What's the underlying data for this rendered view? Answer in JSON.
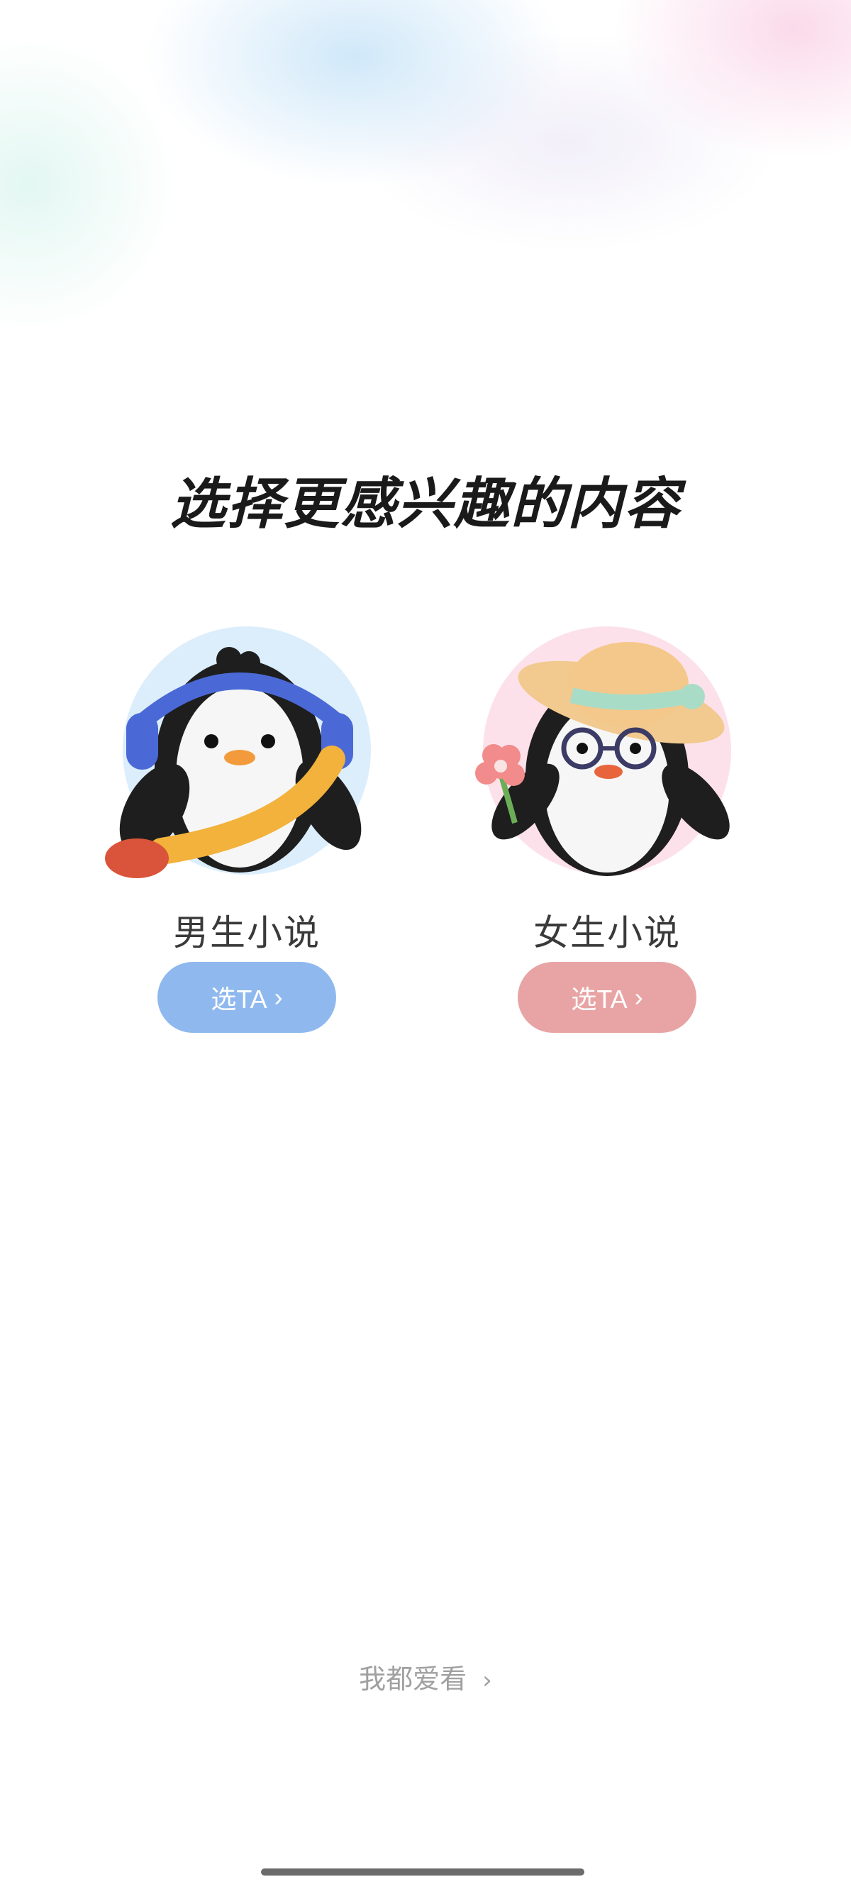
{
  "page": {
    "title": "选择更感兴趣的内容"
  },
  "options": [
    {
      "label": "男生小说",
      "button_label": "选TA",
      "button_chevron": "›",
      "accent": "#8fb9ee",
      "avatar_icon": "penguin-headphones-icon"
    },
    {
      "label": "女生小说",
      "button_label": "选TA",
      "button_chevron": "›",
      "accent": "#e8a4a4",
      "avatar_icon": "penguin-sunhat-flower-icon"
    }
  ],
  "footer": {
    "all_label": "我都爱看",
    "all_chevron": "›"
  }
}
